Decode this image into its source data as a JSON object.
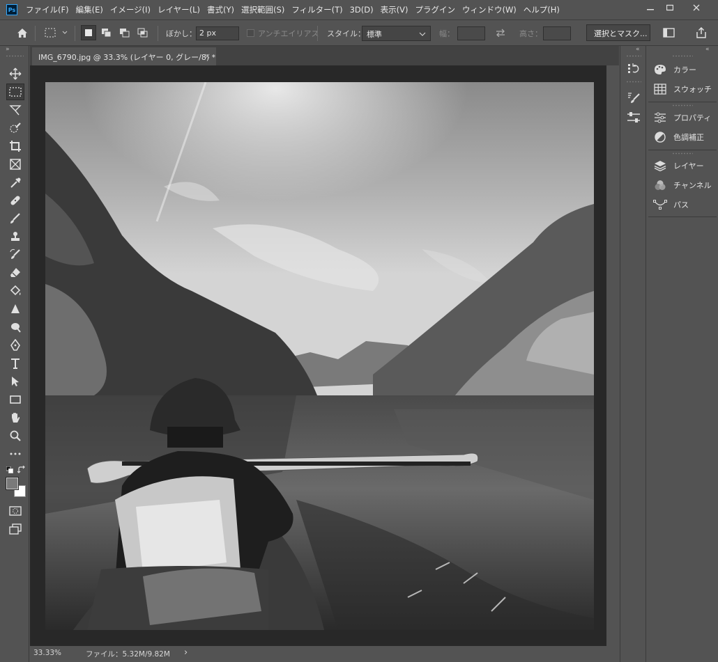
{
  "menubar": {
    "logo": "Ps",
    "items": [
      "ファイル(F)",
      "編集(E)",
      "イメージ(I)",
      "レイヤー(L)",
      "書式(Y)",
      "選択範囲(S)",
      "フィルター(T)",
      "3D(D)",
      "表示(V)",
      "プラグイン",
      "ウィンドウ(W)",
      "ヘルプ(H)"
    ],
    "window_controls": [
      "minimize",
      "maximize",
      "close"
    ]
  },
  "options": {
    "feather_label": "ぼかし：",
    "feather_value": "2 px",
    "antialias_label": "アンチエイリアス",
    "style_label": "スタイル：",
    "style_value": "標準",
    "width_label": "幅：",
    "height_label": "高さ：",
    "select_mask_button": "選択とマスク..."
  },
  "document": {
    "tab_title": "IMG_6790.jpg @ 33.3% (レイヤー 0, グレー/8) *",
    "zoom": "33.33%",
    "file_info": "ファイル：5.32M/9.82M",
    "status_arrow": "›"
  },
  "panels": [
    {
      "label": "カラー",
      "icon": "color-palette-icon"
    },
    {
      "label": "スウォッチ",
      "icon": "swatches-grid-icon"
    },
    {
      "label": "プロパティ",
      "icon": "properties-sliders-icon"
    },
    {
      "label": "色調補正",
      "icon": "adjustments-circle-icon"
    },
    {
      "label": "レイヤー",
      "icon": "layers-icon"
    },
    {
      "label": "チャンネル",
      "icon": "channels-icon"
    },
    {
      "label": "パス",
      "icon": "paths-icon"
    }
  ],
  "tools": [
    "move-tool",
    "rectangular-marquee-tool",
    "lasso-tool",
    "quick-selection-tool",
    "crop-tool",
    "frame-tool",
    "eyedropper-tool",
    "healing-brush-tool",
    "brush-tool",
    "clone-stamp-tool",
    "history-brush-tool",
    "eraser-tool",
    "paint-bucket-tool",
    "blur-tool",
    "dodge-tool",
    "pen-tool",
    "type-tool",
    "path-selection-tool",
    "rectangle-tool",
    "hand-tool",
    "zoom-tool",
    "edit-toolbar",
    "default-colors",
    "swap-colors",
    "foreground-background-colors",
    "quick-mask-mode",
    "screen-mode"
  ],
  "colors": {
    "ui_bg": "#535353",
    "canvas_bg": "#282828",
    "accent": "#31a8ff"
  }
}
